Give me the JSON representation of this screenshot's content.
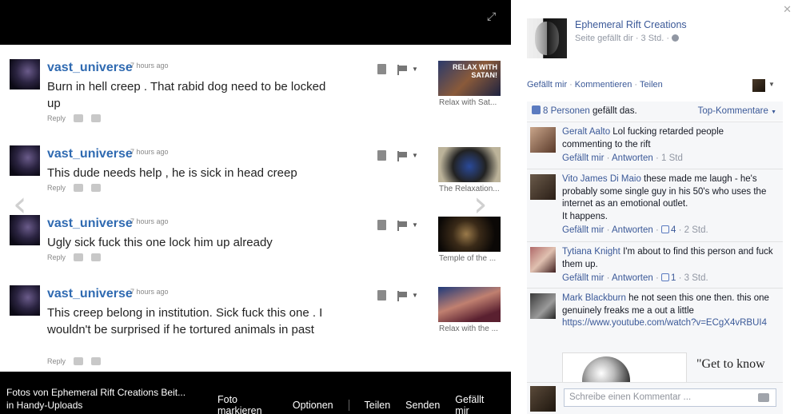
{
  "stage": {
    "yt_comments": [
      {
        "user": "vast_universe",
        "time": "7 hours ago",
        "text": "Burn in hell creep . That rabid dog need to be locked up",
        "reply": "Reply",
        "thumb_caption": "Relax with Sat...",
        "thumb_text": "RELAX WITH SATAN!"
      },
      {
        "user": "vast_universe",
        "time": "7 hours ago",
        "text": "This dude needs help , he is sick in head creep",
        "reply": "Reply",
        "thumb_caption": "The Relaxation...",
        "thumb_text": ""
      },
      {
        "user": "vast_universe",
        "time": "7 hours ago",
        "text": "Ugly sick fuck this one lock him up already",
        "reply": "Reply",
        "thumb_caption": "Temple of the ...",
        "thumb_text": ""
      },
      {
        "user": "vast_universe",
        "time": "7 hours ago",
        "text": "This creep belong in institution. Sick fuck this one . I wouldn't be surprised if he tortured animals in past",
        "reply": "Reply",
        "thumb_caption": "Relax with the ...",
        "thumb_text": ""
      }
    ],
    "caption": {
      "title": "Fotos von Ephemeral Rift Creations Beit...",
      "subtitle": "in Handy-Uploads",
      "menu": [
        "Foto markieren",
        "Optionen",
        "Teilen",
        "Senden",
        "Gefällt mir"
      ]
    }
  },
  "sidebar": {
    "page_name": "Ephemeral Rift Creations",
    "page_sub": "Seite gefällt dir · 3 Std. ·",
    "actions": [
      "Gefällt mir",
      "Kommentieren",
      "Teilen"
    ],
    "likes_count": "8 Personen",
    "likes_suffix": " gefällt das.",
    "top_comments": "Top-Kommentare",
    "comments": [
      {
        "name": "Geralt Aalto",
        "text": " Lol fucking retarded people commenting to the rift",
        "like": "Gefällt mir",
        "reply": "Antworten",
        "likes": "",
        "time": "1 Std"
      },
      {
        "name": "Vito James Di Maio",
        "text": " these made me laugh - he's probably some single guy in his 50's who uses the internet as an emotional outlet.",
        "text2": "It happens.",
        "like": "Gefällt mir",
        "reply": "Antworten",
        "likes": "4",
        "time": "2 Std."
      },
      {
        "name": "Tytiana Knight",
        "text": " I'm about to find this person and fuck them up.",
        "like": "Gefällt mir",
        "reply": "Antworten",
        "likes": "1",
        "time": "3 Std."
      },
      {
        "name": "Mark Blackburn",
        "text": " he not seen this one then. this one genuinely freaks me a out a little",
        "link": "https://www.youtube.com/watch?v=ECgX4vRBUI4",
        "preview_text": "\"Get to know"
      }
    ],
    "compose_placeholder": "Schreibe einen Kommentar ..."
  }
}
